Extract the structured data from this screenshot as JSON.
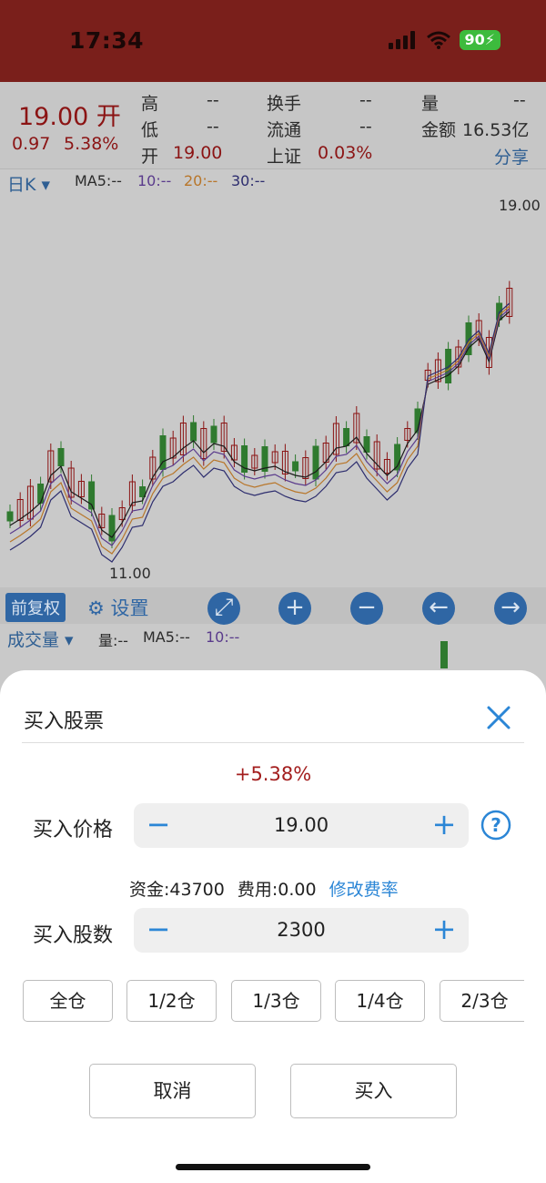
{
  "status_bar": {
    "time": "17:34",
    "battery": "90"
  },
  "quote": {
    "price": "19.00 开",
    "change": "0.97",
    "change_pct": "5.38%",
    "fields": [
      {
        "label": "高",
        "value": "--"
      },
      {
        "label": "低",
        "value": "--"
      },
      {
        "label": "开",
        "value": "19.00"
      },
      {
        "label": "换手",
        "value": "--"
      },
      {
        "label": "流通",
        "value": "--"
      },
      {
        "label": "上证",
        "value": "0.03%"
      },
      {
        "label": "量",
        "value": "--"
      },
      {
        "label": "金额",
        "value": "16.53亿"
      }
    ],
    "share": "分享"
  },
  "kline": {
    "period": "日K",
    "ma5": "MA5:--",
    "ma10": "10:--",
    "ma20": "20:--",
    "ma30": "30:--",
    "high_label": "19.00",
    "low_label": "11.00"
  },
  "chart_toolbar": {
    "adjust": "前复权",
    "settings": "设置"
  },
  "volume": {
    "title": "成交量",
    "vol": "量:--",
    "ma5": "MA5:--",
    "ma10": "10:--"
  },
  "buy_sheet": {
    "title": "买入股票",
    "change_pct": "+5.38%",
    "price_label": "买入价格",
    "price_value": "19.00",
    "funds_text": "资金:43700",
    "fee_text": "费用:0.00",
    "fee_link": "修改费率",
    "shares_label": "买入股数",
    "shares_value": "2300",
    "positions": [
      "全仓",
      "1/2仓",
      "1/3仓",
      "1/4仓",
      "2/3仓"
    ],
    "cancel": "取消",
    "buy": "买入"
  },
  "colors": {
    "header": "#7a1f1b",
    "accent": "#2b86d6",
    "up": "#a31e1e",
    "down": "#2f7a2f"
  }
}
